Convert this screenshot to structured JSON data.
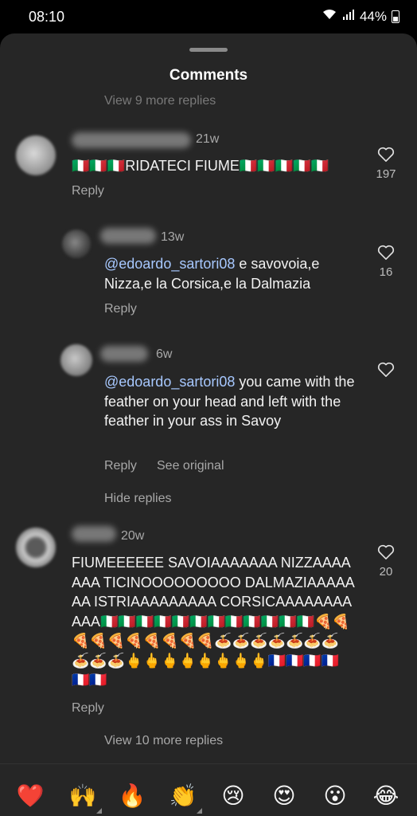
{
  "status_bar": {
    "time": "08:10",
    "battery": "44%"
  },
  "sheet": {
    "title": "Comments",
    "view_more_top": "View 9 more replies"
  },
  "comments": [
    {
      "time": "21w",
      "text": "🇮🇹🇮🇹🇮🇹RIDATECI FIUME🇮🇹🇮🇹🇮🇹🇮🇹🇮🇹",
      "reply_label": "Reply",
      "likes": "197"
    },
    {
      "time": "13w",
      "mention": "@edoardo_sartori08",
      "text": " e savovoia,e Nizza,e la Corsica,e la Dalmazia",
      "reply_label": "Reply",
      "likes": "16"
    },
    {
      "time": "6w",
      "mention": "@edoardo_sartori08",
      "text": " you came with the feather on your head and left with the feather in your ass in Savoy",
      "reply_label": "Reply",
      "see_original": "See original"
    },
    {
      "time": "20w",
      "text": "FIUMEEEEEE SAVOIAAAAAAA NIZZAAAAAAA TICINOOOOOOOOO DALMAZIAAAAAAA ISTRIAAAAAAAAA CORSICAAAAAAAAAAA🇮🇹🇮🇹🇮🇹🇮🇹🇮🇹🇮🇹🇮🇹🇮🇹🇮🇹🇮🇹🇮🇹🇮🇹🍕🍕🍕🍕🍕🍕🍕🍕🍕🍕🍝🍝🍝🍝🍝🍝🍝🍝🍝🍝🖕🖕🖕🖕🖕🖕🖕🖕🇫🇷🇫🇷🇫🇷🇫🇷🇫🇷🇫🇷",
      "reply_label": "Reply",
      "likes": "20"
    }
  ],
  "hide_replies": "Hide replies",
  "view_more_bottom": "View 10 more replies",
  "emoji_bar": [
    "❤️",
    "🙌",
    "🔥",
    "👏",
    "😢",
    "😍",
    "😮",
    "😂"
  ]
}
